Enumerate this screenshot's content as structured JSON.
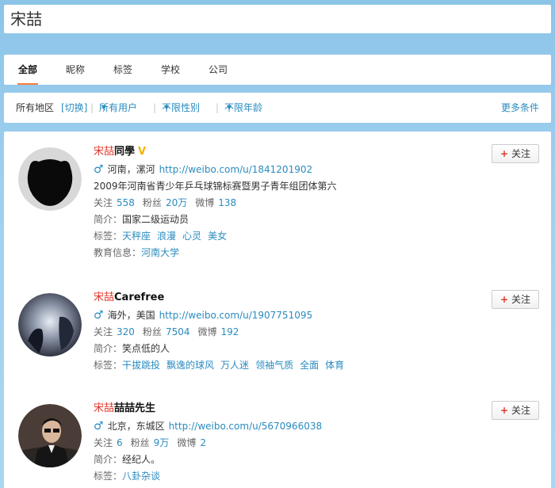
{
  "search": {
    "query": "宋喆"
  },
  "tabs": [
    {
      "label": "全部",
      "active": true
    },
    {
      "label": "昵称",
      "active": false
    },
    {
      "label": "标签",
      "active": false
    },
    {
      "label": "学校",
      "active": false
    },
    {
      "label": "公司",
      "active": false
    }
  ],
  "filters": {
    "region": "所有地区",
    "switch": "[切换]",
    "users": "所有用户",
    "gender": "不限性别",
    "age": "不限年龄",
    "more": "更多条件",
    "separator": "|"
  },
  "labels": {
    "follow_button": "关注",
    "following": "关注",
    "fans": "粉丝",
    "weibo": "微博",
    "intro": "简介：",
    "tags": "标签：",
    "education": "教育信息："
  },
  "results": [
    {
      "name_highlight": "宋喆",
      "name_rest": "同學",
      "verified": true,
      "location": "河南，漯河",
      "url": "http://weibo.com/u/1841201902",
      "description": "2009年河南省青少年乒乓球锦标赛暨男子青年组团体第六",
      "following": "558",
      "fans": "20万",
      "weibo": "138",
      "intro": "国家二级运动员",
      "tags": [
        "天秤座",
        "浪漫",
        "心灵",
        "美女"
      ],
      "education": "河南大学"
    },
    {
      "name_highlight": "宋喆",
      "name_rest": "Carefree",
      "verified": false,
      "location": "海外，美国",
      "url": "http://weibo.com/u/1907751095",
      "following": "320",
      "fans": "7504",
      "weibo": "192",
      "intro": "笑点低的人",
      "tags": [
        "干拔跳投",
        "飘逸的球风",
        "万人迷",
        "领袖气质",
        "全面",
        "体育"
      ]
    },
    {
      "name_highlight": "宋喆",
      "name_rest": "喆喆先生",
      "verified": false,
      "location": "北京，东城区",
      "url": "http://weibo.com/u/5670966038",
      "following": "6",
      "fans": "9万",
      "weibo": "2",
      "intro": "经纪人。",
      "tags": [
        "八卦杂谈"
      ]
    }
  ],
  "colors": {
    "accent": "#2a8bbf",
    "highlight": "#e2372a",
    "background": "#9fd0ef"
  }
}
